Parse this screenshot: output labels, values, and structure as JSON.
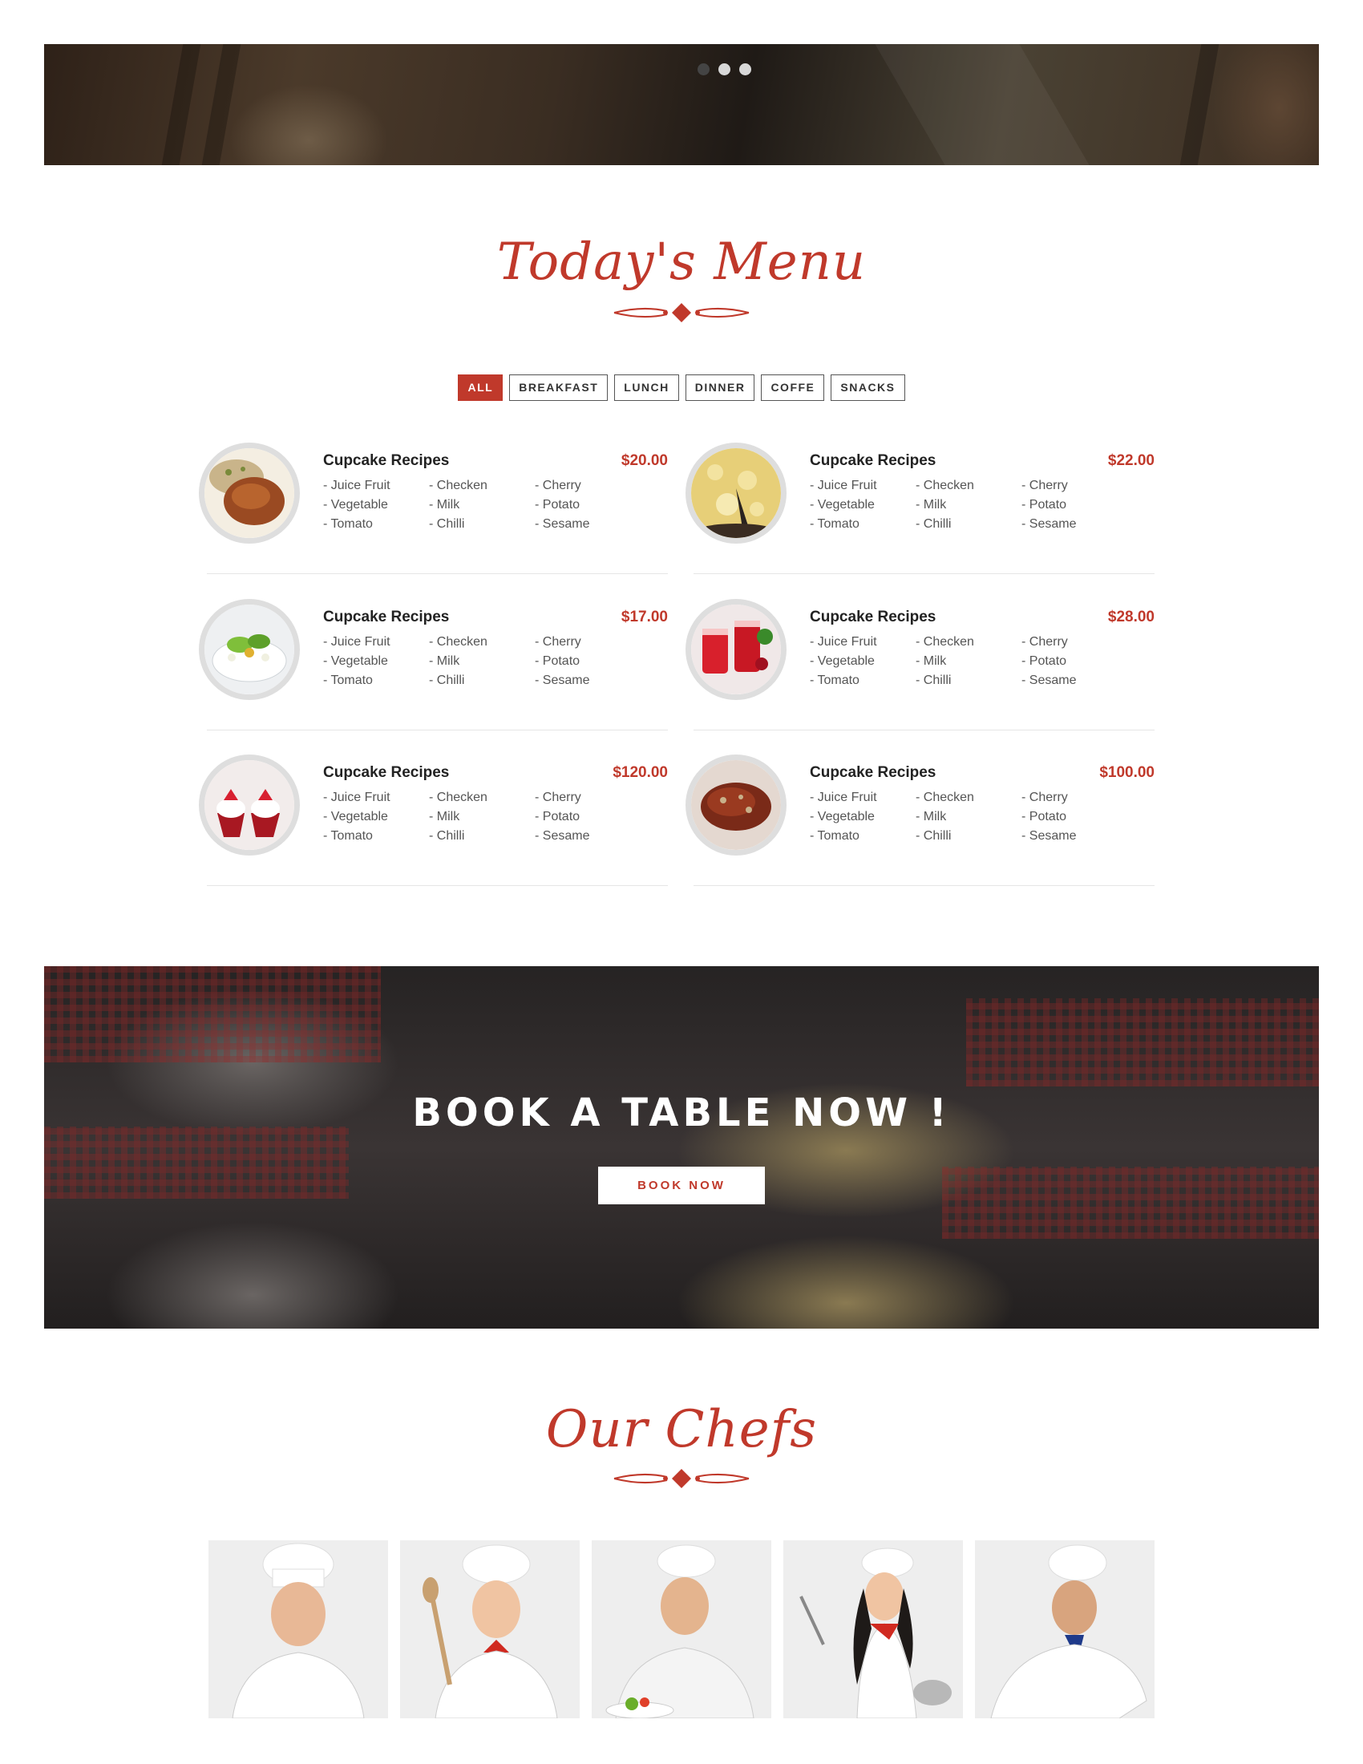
{
  "hero": {
    "active_slide": 2,
    "slide_count": 3
  },
  "menu_section": {
    "title": "Today's Menu",
    "filters": [
      "ALL",
      "BREAKFAST",
      "LUNCH",
      "DINNER",
      "COFFE",
      "SNACKS"
    ],
    "active_filter": "ALL",
    "items": [
      {
        "name": "Cupcake Recipes",
        "price": "$20.00",
        "image": "roast-chicken",
        "ingredients": [
          "- Juice Fruit",
          "- Checken",
          "- Cherry",
          "- Vegetable",
          "- Milk",
          "- Potato",
          "- Tomato",
          "- Chilli",
          "- Sesame"
        ]
      },
      {
        "name": "Cupcake Recipes",
        "price": "$22.00",
        "image": "cheese-pizza",
        "ingredients": [
          "- Juice Fruit",
          "- Checken",
          "- Cherry",
          "- Vegetable",
          "- Milk",
          "- Potato",
          "- Tomato",
          "- Chilli",
          "- Sesame"
        ]
      },
      {
        "name": "Cupcake Recipes",
        "price": "$17.00",
        "image": "salad",
        "ingredients": [
          "- Juice Fruit",
          "- Checken",
          "- Cherry",
          "- Vegetable",
          "- Milk",
          "- Potato",
          "- Tomato",
          "- Chilli",
          "- Sesame"
        ]
      },
      {
        "name": "Cupcake Recipes",
        "price": "$28.00",
        "image": "red-drinks",
        "ingredients": [
          "- Juice Fruit",
          "- Checken",
          "- Cherry",
          "- Vegetable",
          "- Milk",
          "- Potato",
          "- Tomato",
          "- Chilli",
          "- Sesame"
        ]
      },
      {
        "name": "Cupcake Recipes",
        "price": "$120.00",
        "image": "strawberry-cupcakes",
        "ingredients": [
          "- Juice Fruit",
          "- Checken",
          "- Cherry",
          "- Vegetable",
          "- Milk",
          "- Potato",
          "- Tomato",
          "- Chilli",
          "- Sesame"
        ]
      },
      {
        "name": "Cupcake Recipes",
        "price": "$100.00",
        "image": "meatloaf",
        "ingredients": [
          "- Juice Fruit",
          "- Checken",
          "- Cherry",
          "- Vegetable",
          "- Milk",
          "- Potato",
          "- Tomato",
          "- Chilli",
          "- Sesame"
        ]
      }
    ]
  },
  "booking": {
    "title": "BOOK A TABLE NOW !",
    "button": "BOOK NOW"
  },
  "chefs_section": {
    "title": "Our Chefs",
    "chefs": [
      {
        "photo": "male-chef-1"
      },
      {
        "photo": "female-chef-spoon"
      },
      {
        "photo": "male-chef-salad"
      },
      {
        "photo": "female-chef-whisk"
      },
      {
        "photo": "senior-chef"
      }
    ]
  },
  "colors": {
    "accent": "#c0392b",
    "text_dark": "#222222",
    "text_muted": "#555555",
    "rule": "#e6e6e6"
  }
}
